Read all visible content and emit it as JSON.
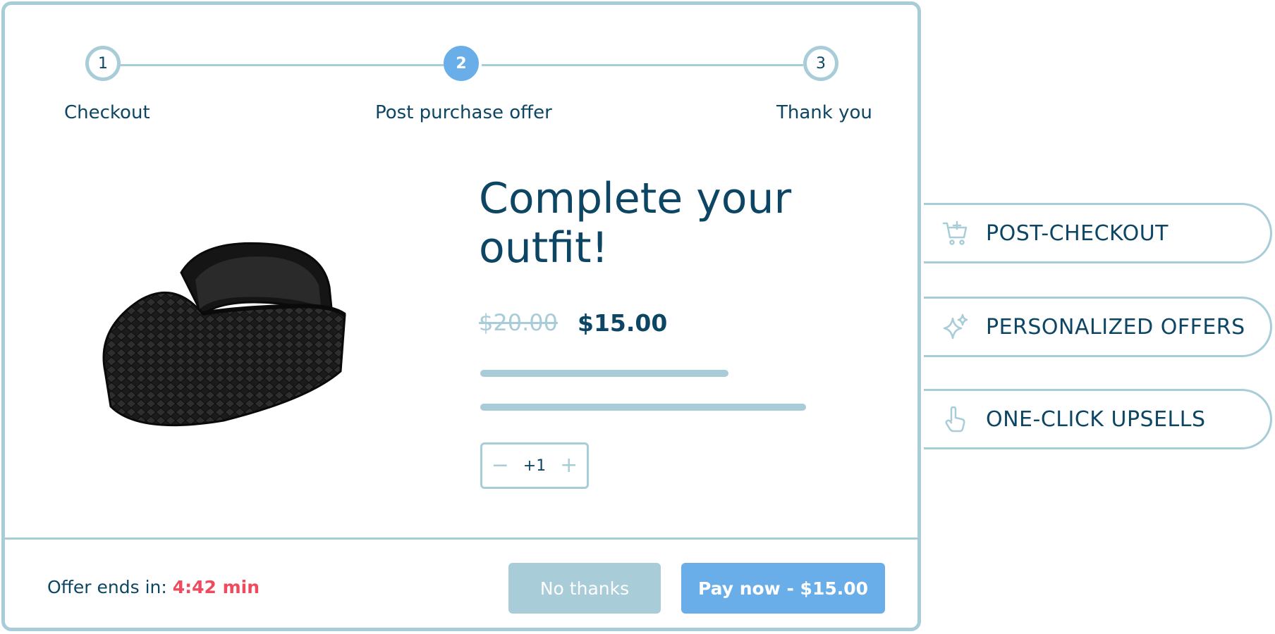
{
  "steps": [
    {
      "number": "1",
      "label": "Checkout"
    },
    {
      "number": "2",
      "label": "Post purchase offer"
    },
    {
      "number": "3",
      "label": "Thank you"
    }
  ],
  "active_step": 2,
  "product": {
    "image_icon": "sun-visor-hat",
    "title": "Complete your outfit!",
    "original_price": "$20.00",
    "sale_price": "$15.00"
  },
  "quantity": {
    "minus_icon": "minus-icon",
    "value": "+1",
    "plus_icon": "plus-icon"
  },
  "footer": {
    "offer_label": "Offer ends in:",
    "timer": "4:42 min",
    "no_thanks_label": "No thanks",
    "pay_now_label": "Pay now - $15.00"
  },
  "features": [
    {
      "icon": "cart-plus-icon",
      "label": "POST-CHECKOUT"
    },
    {
      "icon": "sparkles-icon",
      "label": "PERSONALIZED OFFERS"
    },
    {
      "icon": "pointer-hand-icon",
      "label": "ONE-CLICK UPSELLS"
    }
  ],
  "colors": {
    "accent_blue": "#6aaee9",
    "muted_blue": "#a8ccd8",
    "text_navy": "#0d4664",
    "timer_red": "#f04a5e"
  }
}
